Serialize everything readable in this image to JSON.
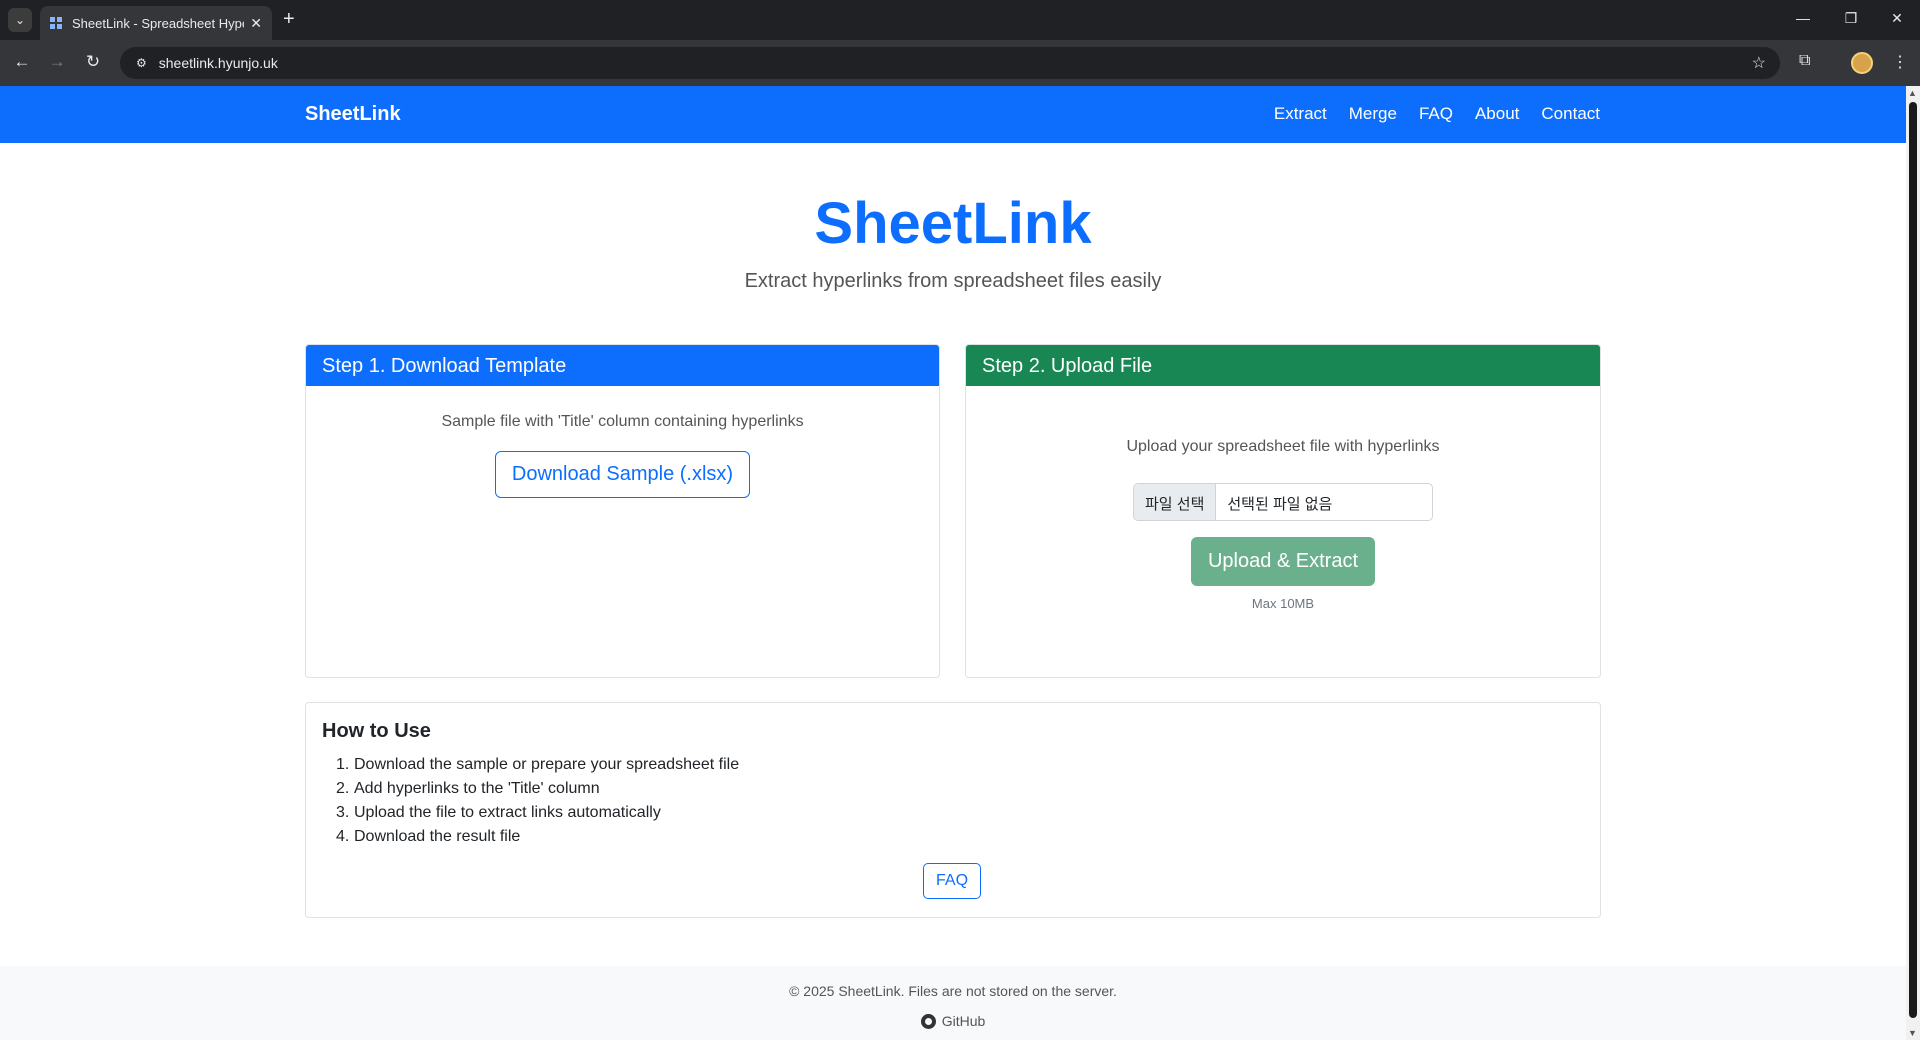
{
  "browser": {
    "tab_title": "SheetLink - Spreadsheet Hyperlink Extractor",
    "tab_close": "✕",
    "new_tab": "+",
    "url": "sheetlink.hyunjo.uk",
    "icons": {
      "tab_search": "chevron-down-icon",
      "back": "back-arrow-icon",
      "forward": "forward-arrow-icon",
      "reload": "reload-icon",
      "site_info": "site-info-icon",
      "bookmark": "star-icon",
      "extensions": "puzzle-icon",
      "menu": "kebab-menu-icon"
    },
    "window_controls": {
      "minimize": "—",
      "restore": "❐",
      "close": "✕"
    }
  },
  "navbar": {
    "brand": "SheetLink",
    "links": [
      "Extract",
      "Merge",
      "FAQ",
      "About",
      "Contact"
    ],
    "color": "#0d6efd"
  },
  "hero": {
    "title": "SheetLink",
    "subtitle": "Extract hyperlinks from spreadsheet files easily"
  },
  "step1": {
    "header": "Step 1. Download Template",
    "description": "Sample file with 'Title' column containing hyperlinks",
    "button": "Download Sample (.xlsx)",
    "color": "#0d6efd"
  },
  "step2": {
    "header": "Step 2. Upload File",
    "description": "Upload your spreadsheet file with hyperlinks",
    "file_button": "파일 선택",
    "file_name": "선택된 파일 없음",
    "upload_button": "Upload & Extract",
    "max_size": "Max 10MB",
    "color": "#198754"
  },
  "howto": {
    "title": "How to Use",
    "steps": [
      "Download the sample or prepare your spreadsheet file",
      "Add hyperlinks to the 'Title' column",
      "Upload the file to extract links automatically",
      "Download the result file"
    ],
    "faq_button": "FAQ"
  },
  "footer": {
    "copyright": "© 2025 SheetLink. Files are not stored on the server.",
    "github": "GitHub"
  }
}
